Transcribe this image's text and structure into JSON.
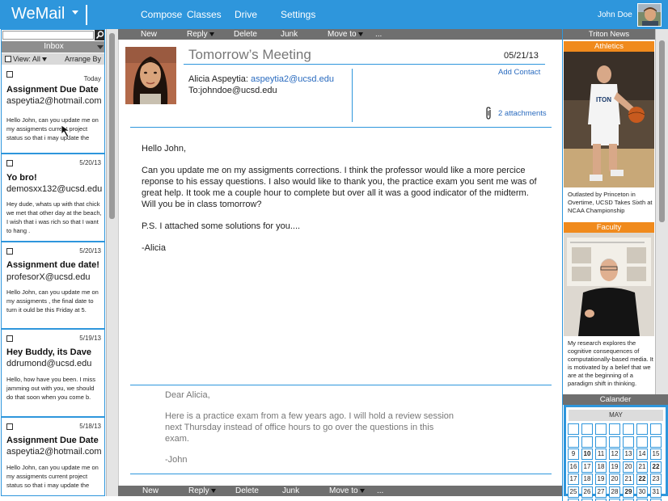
{
  "app": {
    "name": "WeMail"
  },
  "nav": {
    "items": [
      "Compose",
      "Classes",
      "Drive",
      "Settings"
    ],
    "user": "John Doe"
  },
  "inbox": {
    "header": "Inbox",
    "view_label": "View: All",
    "arrange_label": "Arrange By",
    "items": [
      {
        "date": "Today",
        "subject": "Assignment Due Date",
        "from": "aspeytia2@hotmail.com",
        "preview": "Hello John, can you update me on my assigments current project status so that i may update the"
      },
      {
        "date": "5/20/13",
        "subject": "Yo bro!",
        "from": "demosxx132@ucsd.edu",
        "preview": "Hey dude, whats up with that chick we met that other day at the beach, I wish that i was rich so that I want to hang ."
      },
      {
        "date": "5/20/13",
        "subject": "Assignment due date!",
        "from": "profesorX@ucsd.edu",
        "preview": "Hello John, can you update me on my assigments , the final date to turn it ould be this Friday at 5."
      },
      {
        "date": "5/19/13",
        "subject": "Hey Buddy, its Dave",
        "from": "ddrumond@ucsd.edu",
        "preview": "Hello,  how have you been.  I miss jamming out with you, we should do that soon when you come b."
      },
      {
        "date": "5/18/13",
        "subject": "Assignment Due Date",
        "from": "aspeytia2@hotmail.com",
        "preview": "Hello John, can you update me on my assigments current project status so that i may update the"
      }
    ]
  },
  "toolbar": {
    "new": "New",
    "reply": "Reply",
    "delete": "Delete",
    "junk": "Junk",
    "move_to": "Move to",
    "more": "..."
  },
  "message": {
    "subject": "Tomorrow’s Meeting",
    "date": "05/21/13",
    "from_name": "Alicia Aspeytia:",
    "from_email": "aspeytia2@ucsd.edu",
    "to": "To:johndoe@ucsd.edu",
    "add_contact": "Add Contact",
    "attachments": "2 attachments",
    "body": [
      "Hello John,",
      "Can you update me on my assigments corrections.  I think the professor would like a more percice reponse to his essay questions.  I also would like to thank you, the practice exam you sent me was of great help.  It took me a couple hour to complete but over all it was a good indicator of the midterm. Will you be in class tomorrow?",
      "P.S. I attached some solutions for you....",
      "-Alicia"
    ],
    "reply": [
      "Dear Alicia,",
      "Here is a practice exam from a few years ago. I will hold a review session next Thursday instead of office hours to go over the questions in this exam.",
      "-John"
    ]
  },
  "news": {
    "header": "Triton News",
    "items": [
      {
        "category": "Athletics",
        "caption": "Outlasted by Princeton in Overtime, UCSD Takes Sixth at NCAA Championship"
      },
      {
        "category": "Faculty",
        "caption": "My research explores the cognitive consequences of computationally-based media. It is motivated by a belief that we are at the beginning of a paradigm shift in thinking."
      }
    ]
  },
  "calendar": {
    "header": "Calander",
    "month": "MAY",
    "rows": [
      [
        "",
        "",
        "",
        "",
        "",
        "",
        ""
      ],
      [
        "",
        "",
        "",
        "",
        "",
        "",
        ""
      ],
      [
        "9",
        "10",
        "11",
        "12",
        "13",
        "14",
        "15"
      ],
      [
        "16",
        "17",
        "18",
        "19",
        "20",
        "21",
        "22"
      ],
      [
        "17",
        "18",
        "19",
        "20",
        "21",
        "22",
        "23"
      ],
      [
        "25",
        "26",
        "27",
        "28",
        "29",
        "30",
        "31"
      ],
      [
        "",
        "",
        "",
        "",
        "",
        "",
        ""
      ]
    ],
    "bold_days": [
      "10",
      "22",
      "29"
    ]
  },
  "colors": {
    "brand_blue": "#2e96dc",
    "toolbar_gray": "#6f6f6f",
    "news_orange": "#f08a1c",
    "link_blue": "#2a6bbf"
  }
}
